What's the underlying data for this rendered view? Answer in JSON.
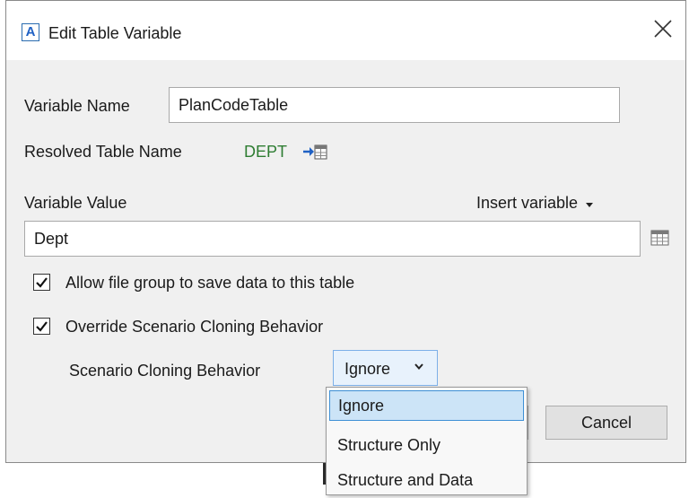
{
  "dialog": {
    "title": "Edit Table Variable",
    "app_icon_letter": "A",
    "close_glyph": "✕"
  },
  "form": {
    "variable_name_label": "Variable Name",
    "variable_name_value": "PlanCodeTable",
    "resolved_label": "Resolved Table Name",
    "resolved_value": "DEPT",
    "variable_value_label": "Variable Value",
    "insert_variable_label": "Insert variable",
    "variable_value": "Dept",
    "allow_save_label": "Allow file group to save data to this table",
    "allow_save_checked": true,
    "override_label": "Override Scenario Cloning Behavior",
    "override_checked": true,
    "cloning_label": "Scenario Cloning Behavior",
    "cloning_selected": "Ignore"
  },
  "dropdown": {
    "options": [
      "Ignore",
      "Structure Only",
      "Structure and Data"
    ],
    "selected_index": 0
  },
  "buttons": {
    "cancel_label": "Cancel"
  },
  "colors": {
    "resolved_green": "#2e7d32",
    "selection_bg": "#cce4f7",
    "selection_border": "#3d8fd6",
    "icon_blue": "#1f61c4"
  }
}
